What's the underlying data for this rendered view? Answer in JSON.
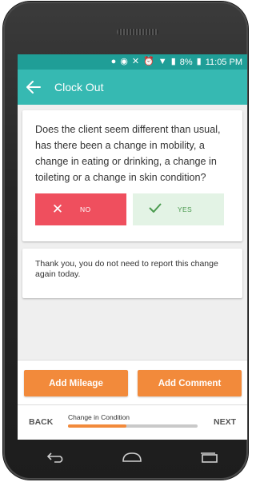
{
  "status_bar": {
    "battery": "8%",
    "time": "11:05 PM",
    "icons": [
      "location-icon",
      "bluetooth-icon",
      "mute-icon",
      "alarm-icon",
      "wifi-icon",
      "signal-icon",
      "battery-icon"
    ]
  },
  "app_bar": {
    "title": "Clock Out"
  },
  "question": {
    "text": "Does the client seem different than usual, has there been a change in mobility, a change in eating or drinking, a change in toileting or a change in skin condition?",
    "no_label": "NO",
    "yes_label": "YES",
    "selected": "YES"
  },
  "info": {
    "text": "Thank you, you do not need to report this change again today."
  },
  "actions": {
    "add_mileage": "Add Mileage",
    "add_comment": "Add Comment"
  },
  "navigation": {
    "back": "BACK",
    "next": "NEXT",
    "step_label": "Change in Condition",
    "progress": 0.45
  },
  "colors": {
    "accent": "#36b9b2",
    "status": "#1f9e97",
    "no": "#ef4f5e",
    "yes_bg": "#e3f3e5",
    "action": "#f28a3b"
  }
}
